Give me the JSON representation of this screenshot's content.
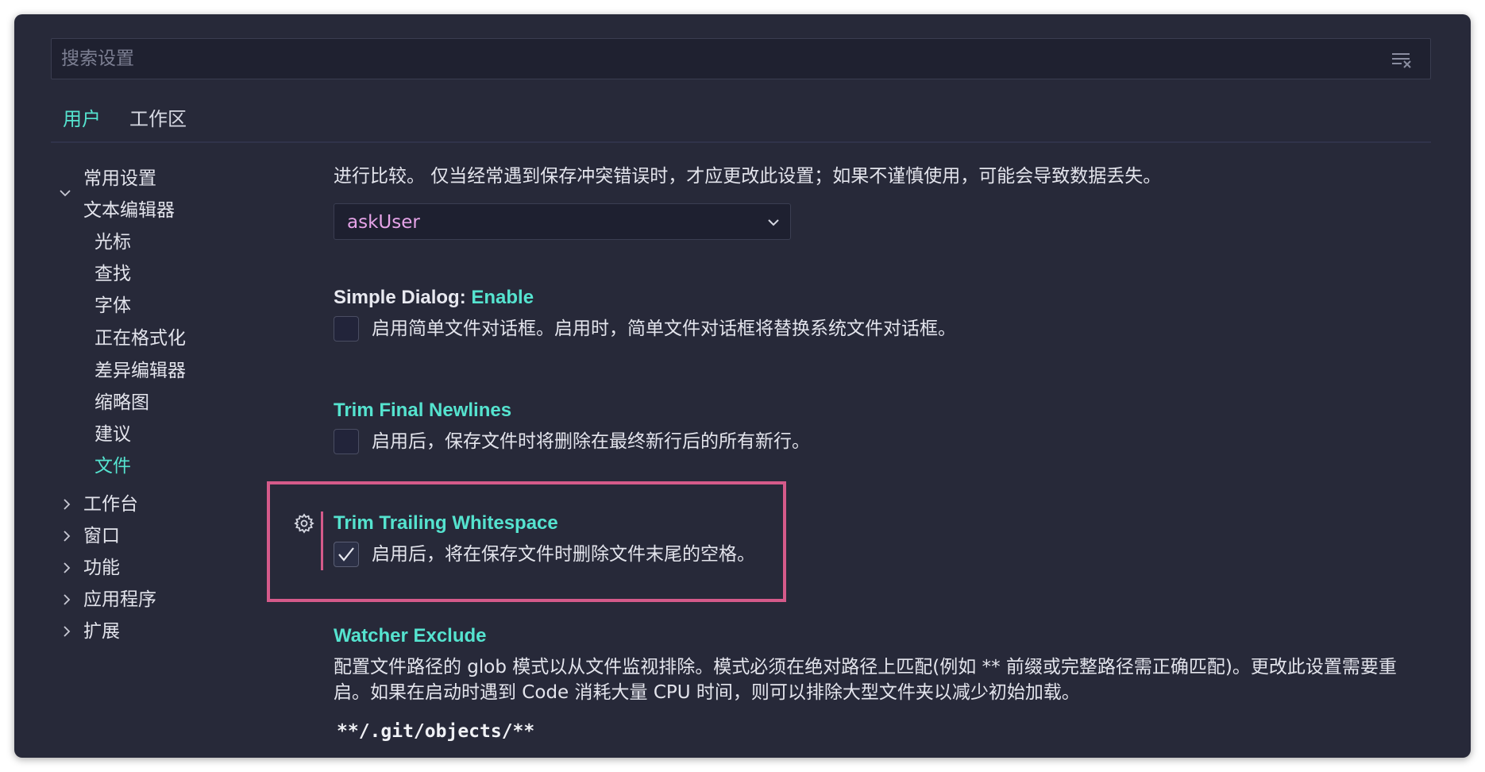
{
  "search": {
    "placeholder": "搜索设置",
    "clear_icon": "clear-filter-icon"
  },
  "tabs": [
    {
      "label": "用户",
      "active": true
    },
    {
      "label": "工作区",
      "active": false
    }
  ],
  "toc": {
    "items": [
      {
        "label": "常用设置",
        "level": 0,
        "expand": "none"
      },
      {
        "label": "文本编辑器",
        "level": 0,
        "expand": "expanded"
      },
      {
        "label": "光标",
        "level": 1
      },
      {
        "label": "查找",
        "level": 1
      },
      {
        "label": "字体",
        "level": 1
      },
      {
        "label": "正在格式化",
        "level": 1
      },
      {
        "label": "差异编辑器",
        "level": 1
      },
      {
        "label": "缩略图",
        "level": 1
      },
      {
        "label": "建议",
        "level": 1
      },
      {
        "label": "文件",
        "level": 1,
        "active": true
      },
      {
        "label": "工作台",
        "level": 0,
        "expand": "collapsed"
      },
      {
        "label": "窗口",
        "level": 0,
        "expand": "collapsed"
      },
      {
        "label": "功能",
        "level": 0,
        "expand": "collapsed"
      },
      {
        "label": "应用程序",
        "level": 0,
        "expand": "collapsed"
      },
      {
        "label": "扩展",
        "level": 0,
        "expand": "collapsed"
      }
    ]
  },
  "settings": {
    "save_conflict": {
      "description_tail": "进行比较。 仅当经常遇到保存冲突错误时，才应更改此设置；如果不谨慎使用，可能会导致数据丢失。",
      "value": "askUser"
    },
    "simple_dialog": {
      "category": "Simple Dialog: ",
      "key": "Enable",
      "description": "启用简单文件对话框。启用时，简单文件对话框将替换系统文件对话框。",
      "checked": false
    },
    "trim_final_newlines": {
      "title": "Trim Final Newlines",
      "description": "启用后，保存文件时将删除在最终新行后的所有新行。",
      "checked": false
    },
    "trim_trailing_whitespace": {
      "title": "Trim Trailing Whitespace",
      "description": "启用后，将在保存文件时删除文件末尾的空格。",
      "checked": true
    },
    "watcher_exclude": {
      "title": "Watcher Exclude",
      "description_line1": "配置文件路径的 glob 模式以从文件监视排除。模式必须在绝对路径上匹配(例如 ** 前缀或完整路径需正确匹配)。更改此设置需要重",
      "description_line2": "启。如果在启动时遇到 Code 消耗大量 CPU 时间，则可以排除大型文件夹以减少初始加载。",
      "entry": "**/.git/objects/**"
    }
  },
  "colors": {
    "background": "#272939",
    "accent": "#55e3cf",
    "highlight": "#d55a8a",
    "enum_value": "#e6a4e8"
  }
}
